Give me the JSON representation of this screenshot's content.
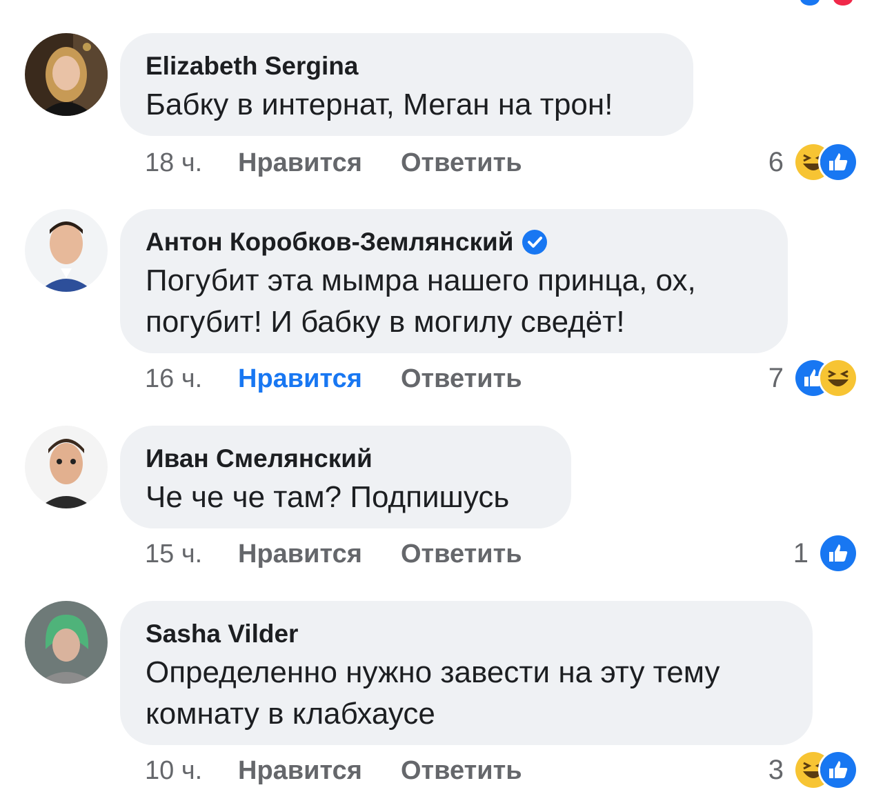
{
  "colors": {
    "bubble": "#eff1f4",
    "text": "#1c1e21",
    "meta": "#65676b",
    "accent_blue": "#1877f2",
    "haha_yellow": "#f7c433"
  },
  "comments": [
    {
      "author": "Elizabeth Sergina",
      "verified": false,
      "lines": [
        "Бабку в интернат, Меган на трон!"
      ],
      "time": "18 ч.",
      "like_label": "Нравится",
      "like_active": false,
      "reply_label": "Ответить",
      "reaction_count": "6",
      "reactions": [
        "haha-icon",
        "like-icon"
      ]
    },
    {
      "author": "Антон Коробков-Землянский",
      "verified": true,
      "lines": [
        "Погубит эта мымра нашего принца, ох,",
        "погубит! И бабку в могилу сведёт!"
      ],
      "time": "16 ч.",
      "like_label": "Нравится",
      "like_active": true,
      "reply_label": "Ответить",
      "reaction_count": "7",
      "reactions": [
        "like-icon",
        "haha-icon"
      ]
    },
    {
      "author": "Иван Смелянский",
      "verified": false,
      "lines": [
        "Че че че там? Подпишусь"
      ],
      "time": "15 ч.",
      "like_label": "Нравится",
      "like_active": false,
      "reply_label": "Ответить",
      "reaction_count": "1",
      "reactions": [
        "like-icon"
      ]
    },
    {
      "author": "Sasha Vilder",
      "verified": false,
      "lines": [
        "Определенно нужно завести на эту тему",
        "комнату в клабхаусе"
      ],
      "time": "10 ч.",
      "like_label": "Нравится",
      "like_active": false,
      "reply_label": "Ответить",
      "reaction_count": "3",
      "reactions": [
        "haha-icon",
        "like-icon"
      ]
    }
  ]
}
